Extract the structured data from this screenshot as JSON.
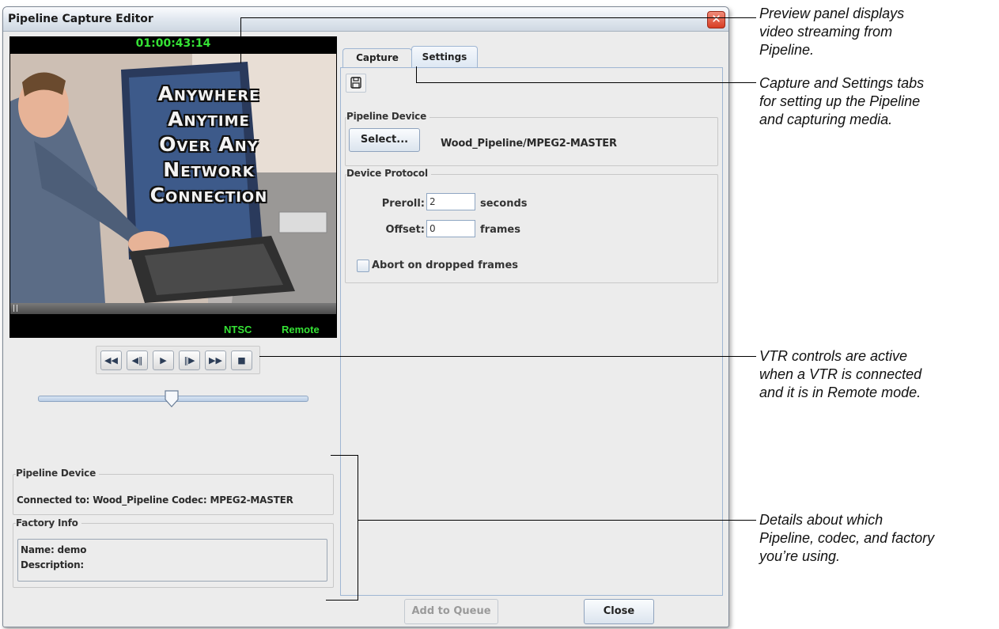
{
  "window": {
    "title": "Pipeline Capture Editor",
    "close_glyph": "✕"
  },
  "preview": {
    "timecode": "01:00:43:14",
    "overlay_lines": [
      "Anywhere",
      "Anytime",
      "Over Any",
      "Network",
      "Connection"
    ],
    "format": "NTSC",
    "mode": "Remote",
    "scroll_value": 0.0
  },
  "vtr_controls": {
    "icons": [
      "rewind-icon",
      "step-back-icon",
      "play-icon",
      "step-forward-icon",
      "fast-forward-icon",
      "stop-icon"
    ],
    "glyphs": [
      "◀◀",
      "◀‖",
      "▶",
      "‖▶",
      "▶▶",
      "■"
    ],
    "slider_value": 0.52
  },
  "left_info": {
    "pipeline_device_label": "Pipeline Device",
    "connected_text": "Connected to: Wood_Pipeline Codec: MPEG2-MASTER",
    "factory_info_label": "Factory Info",
    "name_text": "Name: demo",
    "description_text": "Description:"
  },
  "tabs": {
    "items": [
      {
        "label": "Capture",
        "active": false
      },
      {
        "label": "Settings",
        "active": true
      }
    ]
  },
  "settings": {
    "save_icon": "save-icon",
    "pipeline_device_label": "Pipeline Device",
    "select_button": "Select...",
    "device_name": "Wood_Pipeline/MPEG2-MASTER",
    "device_protocol_label": "Device Protocol",
    "preroll_label": "Preroll:",
    "preroll_value": "2",
    "preroll_unit": "seconds",
    "offset_label": "Offset:",
    "offset_value": "0",
    "offset_unit": "frames",
    "abort_label": "Abort on dropped frames",
    "abort_checked": false
  },
  "buttons": {
    "add_to_queue": "Add to Queue",
    "add_to_queue_enabled": false,
    "close": "Close"
  },
  "callouts": {
    "preview": [
      "Preview panel displays",
      "video streaming from",
      "Pipeline."
    ],
    "tabs": [
      "Capture and Settings tabs",
      "for setting up the Pipeline",
      "and capturing media."
    ],
    "vtr": [
      "VTR controls are active",
      "when a VTR is connected",
      "and it is in Remote mode."
    ],
    "details": [
      "Details about which",
      "Pipeline, codec, and factory",
      "you’re using."
    ]
  },
  "colors": {
    "accent_green": "#35e235",
    "tab_border": "#9fb6d3",
    "close_red": "#d83d24"
  }
}
